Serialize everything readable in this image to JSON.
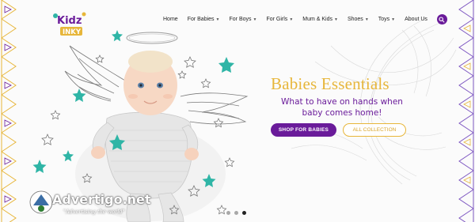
{
  "brand": {
    "logo_text": "KIDZ INKY",
    "colors": {
      "purple": "#6a1b9a",
      "gold": "#e7b63a",
      "teal": "#2fb5a6"
    }
  },
  "nav": {
    "items": [
      {
        "label": "Home",
        "has_caret": false
      },
      {
        "label": "For Babies",
        "has_caret": true
      },
      {
        "label": "For Boys",
        "has_caret": true
      },
      {
        "label": "For Girls",
        "has_caret": true
      },
      {
        "label": "Mum & Kids",
        "has_caret": true
      },
      {
        "label": "Shoes",
        "has_caret": true
      },
      {
        "label": "Toys",
        "has_caret": true
      },
      {
        "label": "About Us",
        "has_caret": false
      }
    ],
    "search_icon": "search-icon"
  },
  "hero": {
    "headline": "Babies Essentials",
    "subline": "What to have on hands when baby comes home!",
    "primary_button": "SHOP FOR BABIES",
    "secondary_button": "ALL COLLECTION",
    "slides": {
      "count": 3,
      "active_index": 2
    }
  },
  "watermark": {
    "text": "Advertigo.net",
    "tagline": "\"Advertising the world\""
  }
}
